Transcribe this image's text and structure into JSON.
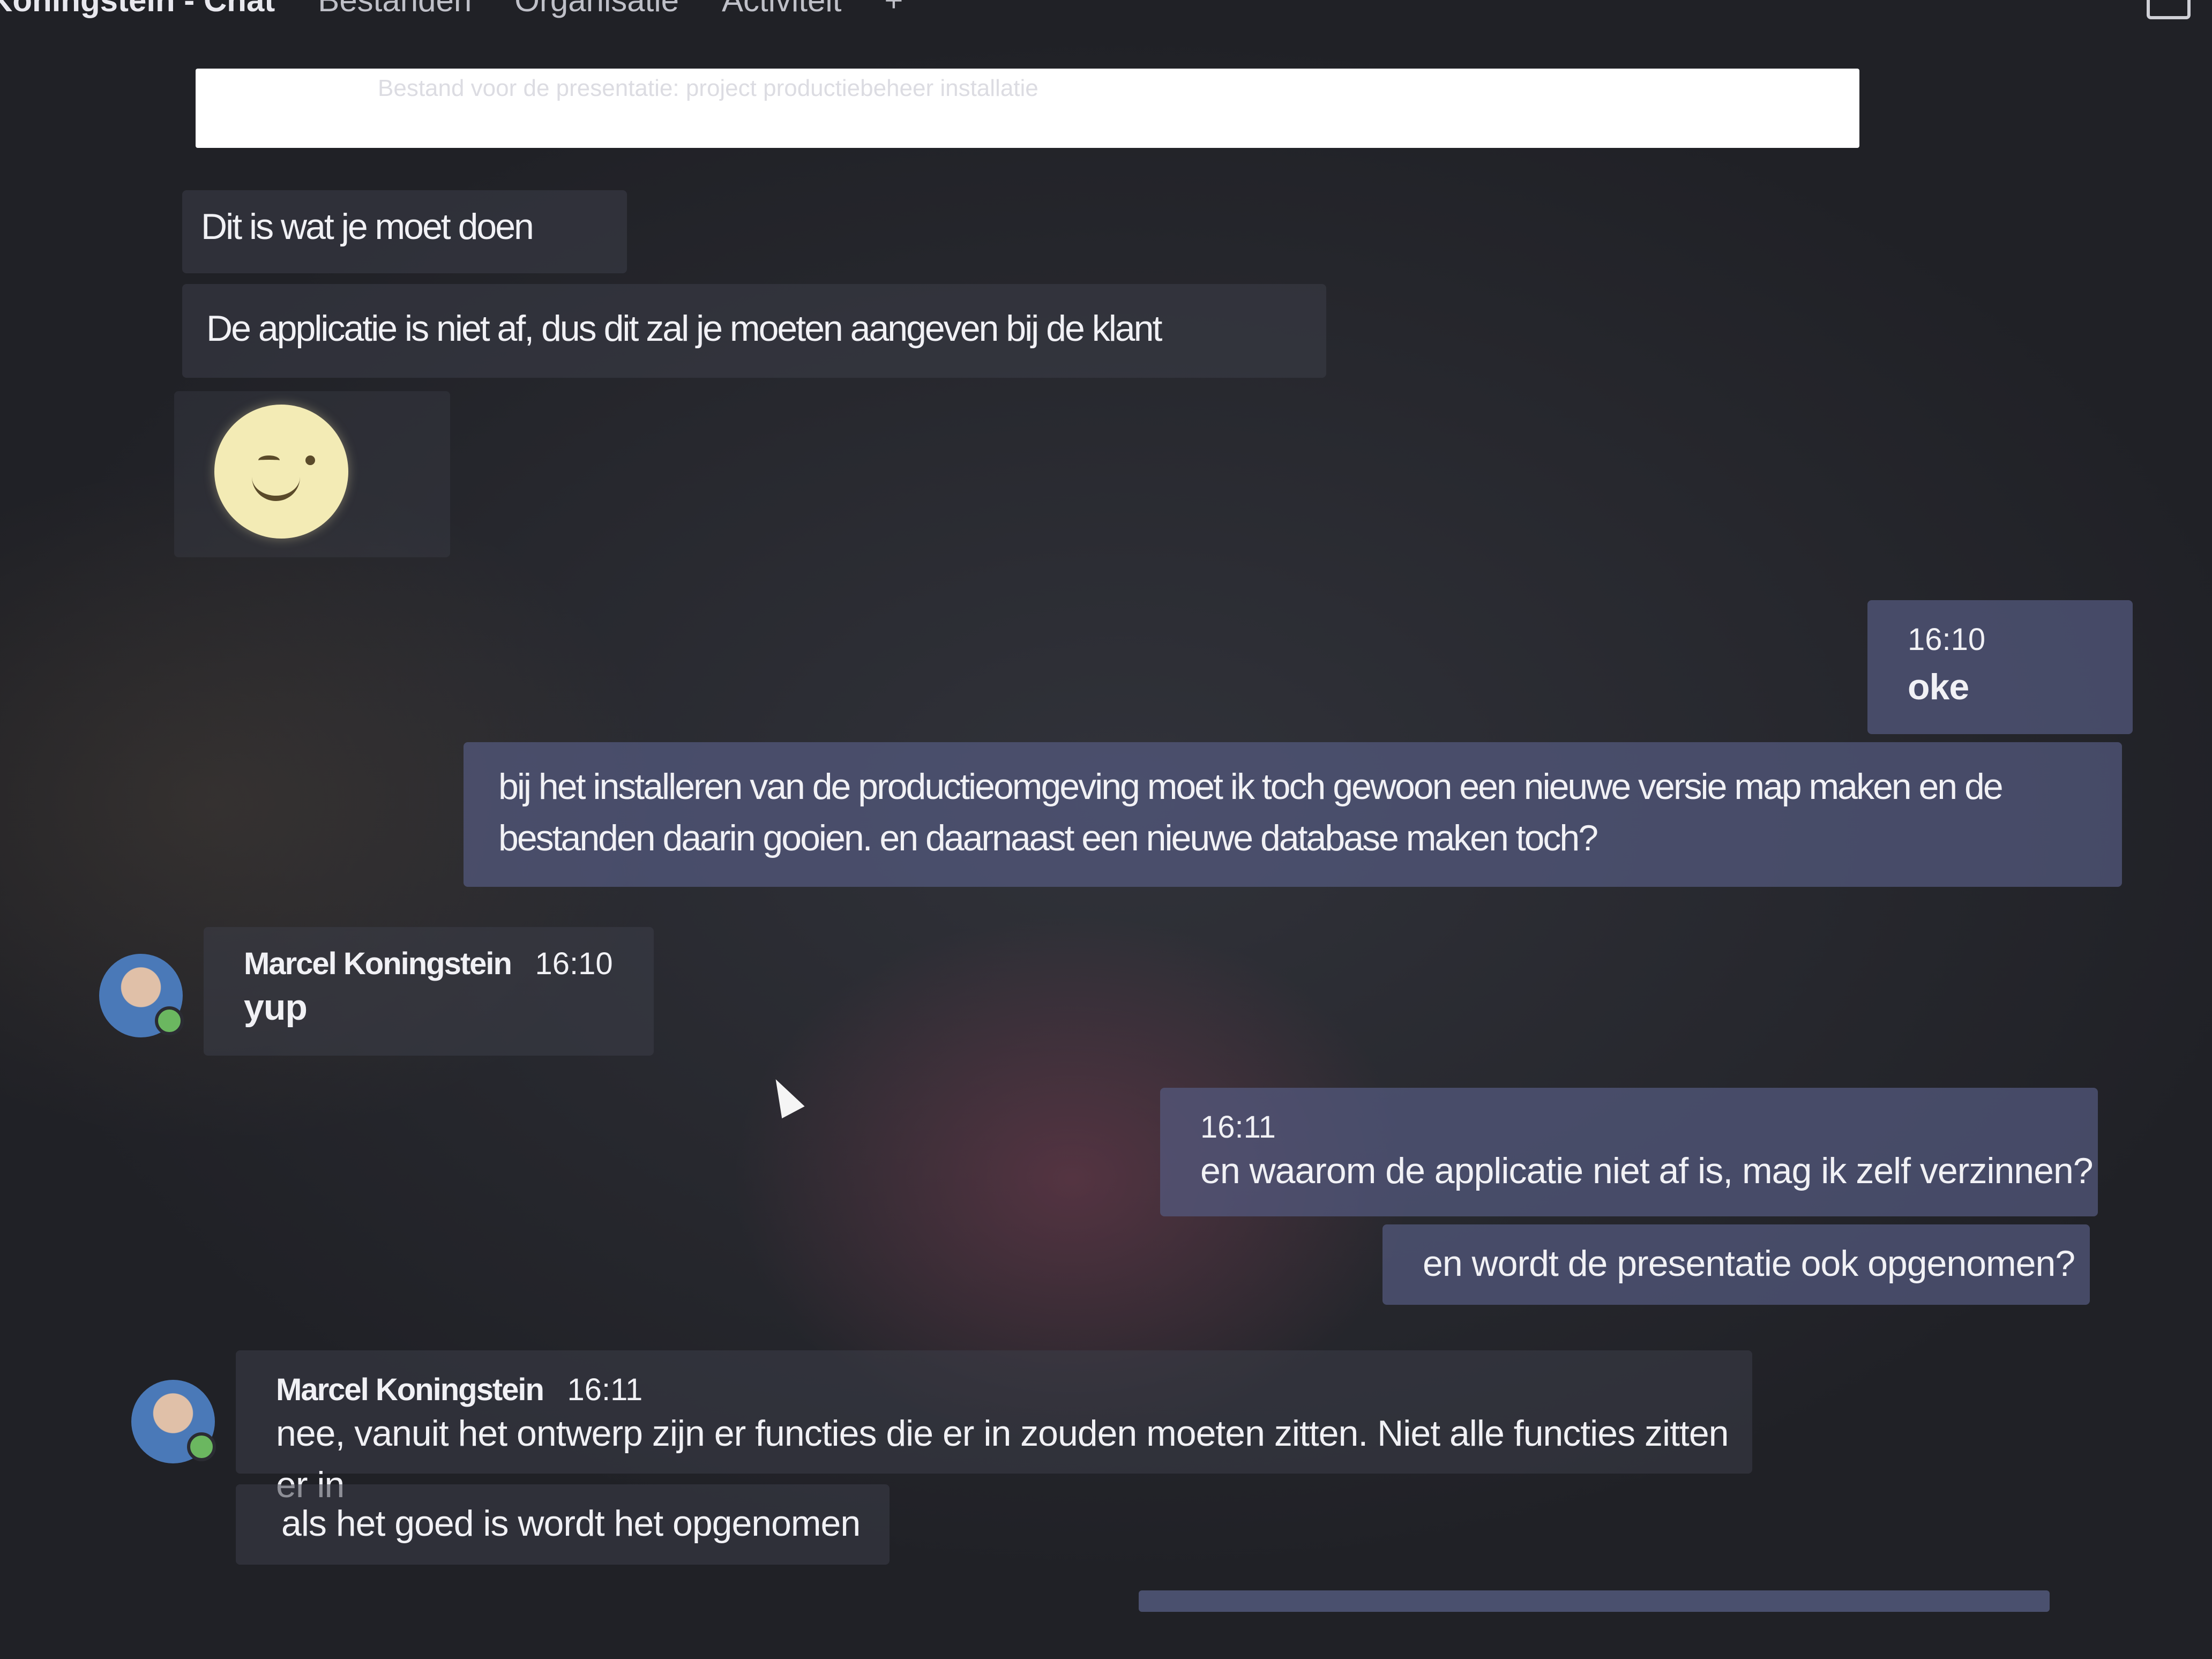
{
  "header": {
    "title": "Koningstein - Chat",
    "tabs": [
      "Bestanden",
      "Organisatie",
      "Activiteit",
      "+"
    ]
  },
  "reply": {
    "quote": "Bestand voor de presentatie: project productiebeheer installatie"
  },
  "messages": [
    {
      "id": "m1",
      "text": "Dit is wat je moet doen"
    },
    {
      "id": "m2",
      "text": "De applicatie is niet af, dus dit zal je moeten aangeven bij de klant"
    },
    {
      "id": "m3",
      "emoji": "wink-emoji"
    },
    {
      "id": "m4",
      "time": "16:10",
      "text": "oke"
    },
    {
      "id": "m5",
      "text": "bij het installeren van de productieomgeving moet ik toch gewoon een nieuwe versie map maken en de bestanden daarin gooien. en daarnaast een nieuwe database  maken toch?"
    },
    {
      "id": "m6",
      "sender": "Marcel Koningstein",
      "time": "16:10",
      "text": "yup"
    },
    {
      "id": "m7",
      "time": "16:11",
      "text": "en waarom de applicatie niet af is, mag ik zelf verzinnen?"
    },
    {
      "id": "m8",
      "text": "en wordt de presentatie ook opgenomen?"
    },
    {
      "id": "m9",
      "sender": "Marcel Koningstein",
      "time": "16:11",
      "text": "nee, vanuit het ontwerp zijn er functies die er in zouden moeten zitten. Niet alle functies zitten er in"
    },
    {
      "id": "m10",
      "text": "als het goed is wordt het opgenomen"
    }
  ],
  "colors": {
    "background": "#2b2c33",
    "incoming_bubble": "#3c3e48",
    "outgoing_bubble": "#545a80",
    "presence_available": "#6bb760"
  }
}
